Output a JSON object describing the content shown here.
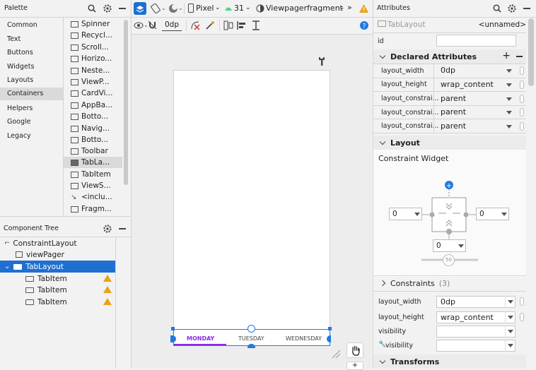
{
  "palette": {
    "title": "Palette",
    "categories": [
      "Common",
      "Text",
      "Buttons",
      "Widgets",
      "Layouts",
      "Containers",
      "Helpers",
      "Google",
      "Legacy"
    ],
    "selected_category": "Containers",
    "items": [
      "Spinner",
      "Recycl...",
      "Scroll...",
      "Horizo...",
      "Neste...",
      "ViewP...",
      "CardVi...",
      "AppBa...",
      "Botto...",
      "Navig...",
      "Botto...",
      "Toolbar",
      "TabLa...",
      "TabItem",
      "ViewS...",
      "<inclu...",
      "Fragm..."
    ],
    "selected_item": "TabLa..."
  },
  "toolbar": {
    "device": "Pixel",
    "api": "31",
    "theme": "Viewpagerfragment",
    "margin": "0dp",
    "more": "»"
  },
  "component_tree": {
    "title": "Component Tree",
    "nodes": [
      {
        "label": "ConstraintLayout",
        "level": 0
      },
      {
        "label": "viewPager",
        "level": 1
      },
      {
        "label": "TabLayout",
        "level": 1,
        "selected": true
      },
      {
        "label": "TabItem",
        "level": 2,
        "warning": true
      },
      {
        "label": "TabItem",
        "level": 2,
        "warning": true
      },
      {
        "label": "TabItem",
        "level": 2,
        "warning": true
      }
    ]
  },
  "canvas": {
    "tabs": [
      "MONDAY",
      "TUESDAY",
      "WEDNESDAY"
    ],
    "selected_tab": "MONDAY"
  },
  "attributes": {
    "title": "Attributes",
    "component": "TabLayout",
    "unnamed": "<unnamed>",
    "id_label": "id",
    "id_value": "",
    "declared_title": "Declared Attributes",
    "declared": [
      {
        "name": "layout_width",
        "value": "0dp"
      },
      {
        "name": "layout_height",
        "value": "wrap_content"
      },
      {
        "name": "layout_constrai...",
        "value": "parent"
      },
      {
        "name": "layout_constrai...",
        "value": "parent"
      },
      {
        "name": "layout_constrai...",
        "value": "parent"
      }
    ],
    "layout_title": "Layout",
    "constraint_widget": "Constraint Widget",
    "margin_left": "0",
    "margin_right": "0",
    "margin_bottom": "0",
    "bias": "50",
    "constraints_label": "Constraints",
    "constraints_count": "(3)",
    "layout_rows": [
      {
        "name": "layout_width",
        "value": "0dp"
      },
      {
        "name": "layout_height",
        "value": "wrap_content"
      },
      {
        "name": "visibility",
        "value": ""
      },
      {
        "name": "visibility",
        "value": ""
      }
    ],
    "transforms_title": "Transforms"
  },
  "colors": {
    "accent": "#1f7ae0",
    "selected_row": "#1f6fd1",
    "tab_selected": "#8a2be2",
    "warning": "#e8a317"
  }
}
